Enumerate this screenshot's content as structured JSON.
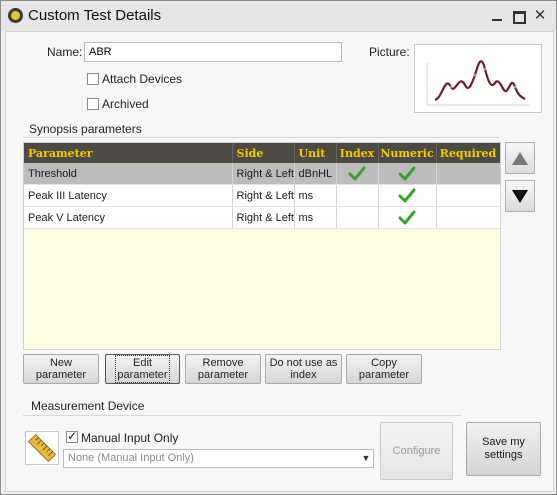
{
  "window": {
    "title": "Custom Test Details",
    "icon": "app-icon",
    "controls": [
      "minimize-icon",
      "maximize-icon",
      "close-icon"
    ]
  },
  "form": {
    "name_label": "Name:",
    "name_value": "ABR",
    "picture_label": "Picture:",
    "attach_devices_label": "Attach Devices",
    "attach_devices_checked": false,
    "archived_label": "Archived",
    "archived_checked": false
  },
  "synopsis": {
    "section_title": "Synopsis parameters",
    "columns": [
      "Parameter",
      "Side",
      "Unit",
      "Index",
      "Numeric",
      "Required"
    ],
    "rows": [
      {
        "parameter": "Threshold",
        "side": "Right & Left",
        "unit": "dBnHL",
        "index": true,
        "numeric": true,
        "required": false,
        "selected": true
      },
      {
        "parameter": "Peak III Latency",
        "side": "Right & Left",
        "unit": "ms",
        "index": false,
        "numeric": true,
        "required": false,
        "selected": false
      },
      {
        "parameter": "Peak V Latency",
        "side": "Right & Left",
        "unit": "ms",
        "index": false,
        "numeric": true,
        "required": false,
        "selected": false
      }
    ],
    "header_text_color": "#f2cc00",
    "header_bg_color": "#4d4a44",
    "empty_area_color": "#fdfde3",
    "check_color": "#3aa02c"
  },
  "actions": {
    "new_parameter": "New\nparameter",
    "edit_parameter": "Edit\nparameter",
    "remove_parameter": "Remove\nparameter",
    "do_not_use_as_index": "Do not use as\nindex",
    "copy_parameter": "Copy\nparameter"
  },
  "measurement": {
    "section_title": "Measurement Device",
    "manual_input_label": "Manual Input Only",
    "manual_input_checked": true,
    "device_select_value": "None (Manual Input Only)",
    "configure_label": "Configure",
    "save_settings_label": "Save my\nsettings",
    "device_icon": "ruler-icon"
  }
}
